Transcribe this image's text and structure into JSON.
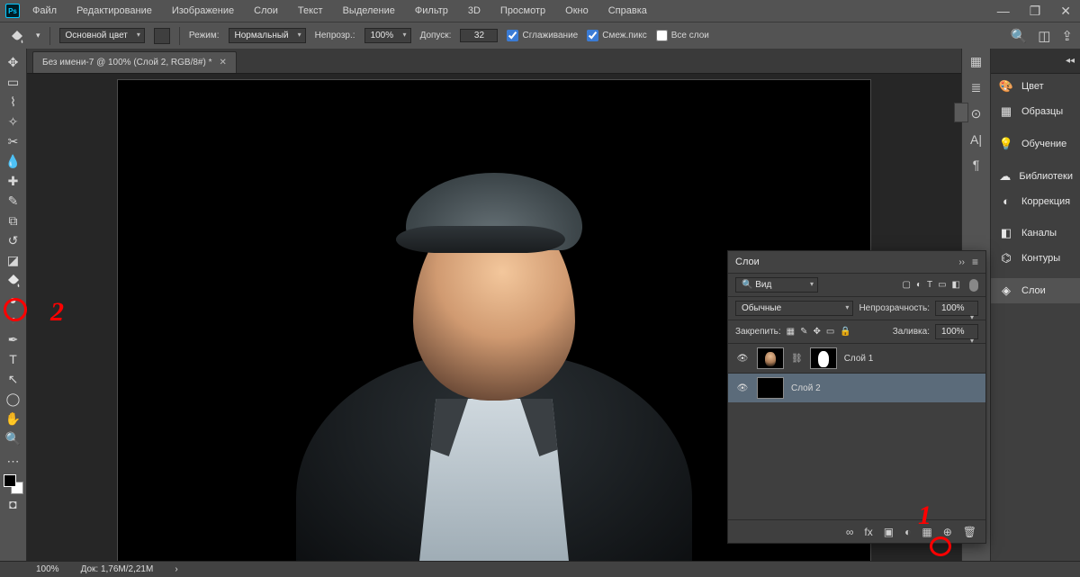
{
  "menu": {
    "items": [
      "Файл",
      "Редактирование",
      "Изображение",
      "Слои",
      "Текст",
      "Выделение",
      "Фильтр",
      "3D",
      "Просмотр",
      "Окно",
      "Справка"
    ]
  },
  "options": {
    "foreground_label": "Основной цвет",
    "mode_label": "Режим:",
    "mode_value": "Нормальный",
    "opacity_label": "Непрозр.:",
    "opacity_value": "100%",
    "tolerance_label": "Допуск:",
    "tolerance_value": "32",
    "anti_alias": "Сглаживание",
    "contiguous": "Смеж.пикс",
    "all_layers": "Все слои"
  },
  "document": {
    "tab_title": "Без имени-7 @ 100% (Слой 2, RGB/8#) *"
  },
  "right_panels": {
    "collapse": "◂◂",
    "items": [
      {
        "icon": "🎨",
        "label": "Цвет"
      },
      {
        "icon": "▦",
        "label": "Образцы"
      },
      {
        "icon": "💡",
        "label": "Обучение"
      },
      {
        "icon": "☁",
        "label": "Библиотеки"
      },
      {
        "icon": "◐",
        "label": "Коррекция"
      },
      {
        "icon": "◧",
        "label": "Каналы"
      },
      {
        "icon": "⌬",
        "label": "Контуры"
      },
      {
        "icon": "◈",
        "label": "Слои"
      }
    ]
  },
  "layers_panel": {
    "title": "Слои",
    "search_placeholder": "Вид",
    "blend_mode": "Обычные",
    "opacity_label": "Непрозрачность:",
    "opacity_value": "100%",
    "lock_label": "Закрепить:",
    "fill_label": "Заливка:",
    "fill_value": "100%",
    "layers": [
      {
        "name": "Слой 1",
        "thumb": "portrait",
        "mask": true,
        "visible": true,
        "selected": false
      },
      {
        "name": "Слой 2",
        "thumb": "black",
        "mask": false,
        "visible": true,
        "selected": true
      }
    ],
    "foot_icons": [
      "∞",
      "fx",
      "▣",
      "◐",
      "▦",
      "⊕",
      "🗑"
    ]
  },
  "annotations": {
    "one": "1",
    "two": "2"
  },
  "status": {
    "zoom": "100%",
    "docsize": "Док: 1,76М/2,21М"
  },
  "iconstrip": [
    "▦",
    "≣",
    "⊙",
    "A|",
    "¶"
  ]
}
